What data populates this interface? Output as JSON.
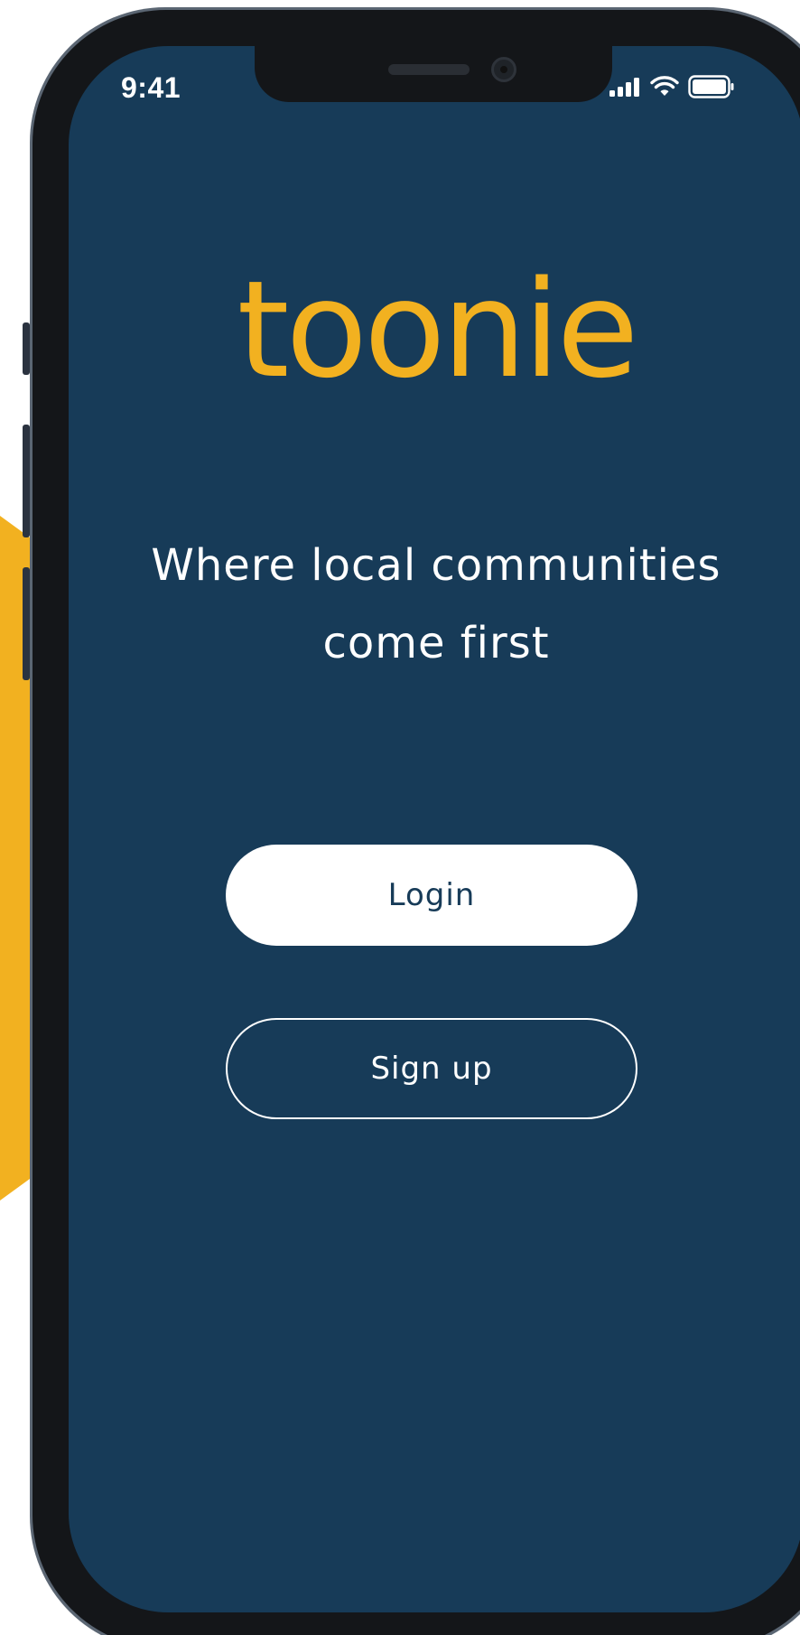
{
  "status_bar": {
    "time": "9:41",
    "icons": [
      "cellular-signal-icon",
      "wifi-icon",
      "battery-icon"
    ]
  },
  "brand": {
    "logo_text": "toonie",
    "accent_color": "#F2B120",
    "background_color": "#173B58"
  },
  "welcome": {
    "tagline_line1": "Where local communities",
    "tagline_line2": "come first"
  },
  "actions": {
    "login_label": "Login",
    "signup_label": "Sign up"
  }
}
